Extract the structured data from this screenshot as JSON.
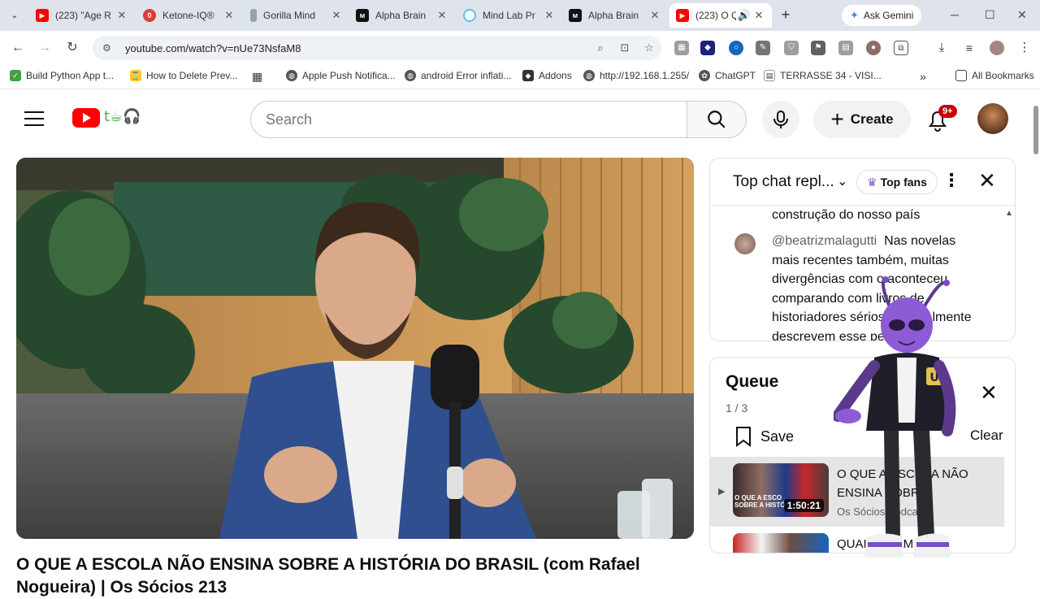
{
  "browser": {
    "tabs": [
      {
        "title": "(223) \"Age R",
        "icon": "youtube-favicon",
        "color": "#ff0000"
      },
      {
        "title": "Ketone-IQ®",
        "icon": "red-circle-favicon",
        "color": "#e53935"
      },
      {
        "title": "Gorilla Mind",
        "icon": "bottle-favicon",
        "color": "#90a4ae"
      },
      {
        "title": "Alpha Brain",
        "icon": "onnit-favicon",
        "color": "#111111"
      },
      {
        "title": "Mind Lab Pr",
        "icon": "hexagon-favicon",
        "color": "#4fc3f7"
      },
      {
        "title": "Alpha Brain",
        "icon": "onnit-favicon",
        "color": "#111111"
      },
      {
        "title": "(223) O Q",
        "icon": "youtube-favicon",
        "color": "#ff0000"
      }
    ],
    "ask_gemini": "Ask Gemini",
    "url": "youtube.com/watch?v=nUe73NsfaM8",
    "bookmarks": [
      "Build Python App t...",
      "How to Delete Prev...",
      "Apple Push Notifica...",
      "android Error inflati...",
      "Addons",
      "http://192.168.1.255/",
      "ChatGPT",
      "TERRASSE 34 - VISI...",
      "All Bookmarks"
    ]
  },
  "youtube": {
    "search_placeholder": "Search",
    "create_label": "Create",
    "notifications_badge": "9+"
  },
  "video": {
    "title": "O QUE A ESCOLA NÃO ENSINA SOBRE A HISTÓRIA DO BRASIL (com Rafael Nogueira) | Os Sócios 213"
  },
  "chat": {
    "header": "Top chat repl...",
    "top_fans": "Top fans",
    "prev_line": "construção do nosso país",
    "author": "@beatrizmalagutti",
    "message": "Nas novelas mais recentes também, muitas divergências com o aconteceu comparando com livros de historiadores sérios que realmente descrevem esse período"
  },
  "queue": {
    "title": "Queue",
    "count": "1 / 3",
    "save_label": "Save",
    "clear_label": "Clear",
    "items": [
      {
        "title": "O QUE A ESCOLA NÃO ENSINA SOBRE",
        "channel": "Os Sócios Podcast",
        "duration": "1:50:21",
        "thumb_text": "O QUE A ESCO SOBRE A HISTÓ"
      },
      {
        "title": "QUAIS ERAM OS",
        "channel": "",
        "duration": ""
      }
    ]
  }
}
